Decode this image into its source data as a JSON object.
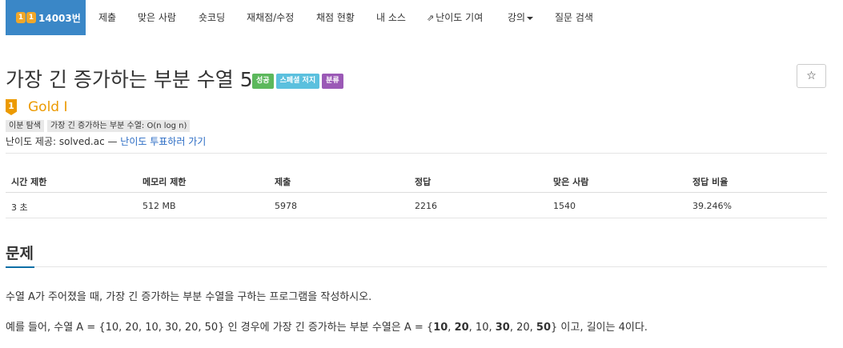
{
  "nav": {
    "active": {
      "coin1": "1",
      "coin2": "1",
      "label": "14003번"
    },
    "items": [
      "제출",
      "맞은 사람",
      "숏코딩",
      "재채점/수정",
      "채점 현황",
      "내 소스",
      "난이도 기여",
      "강의",
      "질문 검색"
    ]
  },
  "problem": {
    "title": "가장 긴 증가하는 부분 수열 5",
    "badges": [
      {
        "label": "성공",
        "color": "#5cb85c"
      },
      {
        "label": "스페셜 저지",
        "color": "#5bc0de"
      },
      {
        "label": "분류",
        "color": "#9b59b6"
      }
    ],
    "star": "☆"
  },
  "tier": {
    "icon_number": "1",
    "name": "Gold I",
    "color": "#ec9a00"
  },
  "tags": [
    "이분 탐색",
    "가장 긴 증가하는 부분 수열: O(n log n)"
  ],
  "provider": {
    "prefix": "난이도 제공: solved.ac — ",
    "link": "난이도 투표하러 가기"
  },
  "stats": {
    "headers": [
      "시간 제한",
      "메모리 제한",
      "제출",
      "정답",
      "맞은 사람",
      "정답 비율"
    ],
    "values": [
      "3 초",
      "512 MB",
      "5978",
      "2216",
      "1540",
      "39.246%"
    ]
  },
  "section": {
    "heading": "문제",
    "p1": "수열 A가 주어졌을 때, 가장 긴 증가하는 부분 수열을 구하는 프로그램을 작성하시오.",
    "p2": {
      "a": "예를 들어, 수열 A = {10, 20, 10, 30, 20, 50} 인 경우에 가장 긴 증가하는 부분 수열은 A = {",
      "b1": "10",
      "c1": ", ",
      "b2": "20",
      "c2": ", 10, ",
      "b3": "30",
      "c3": ", 20, ",
      "b4": "50",
      "d": "} 이고, 길이는 4이다."
    }
  }
}
